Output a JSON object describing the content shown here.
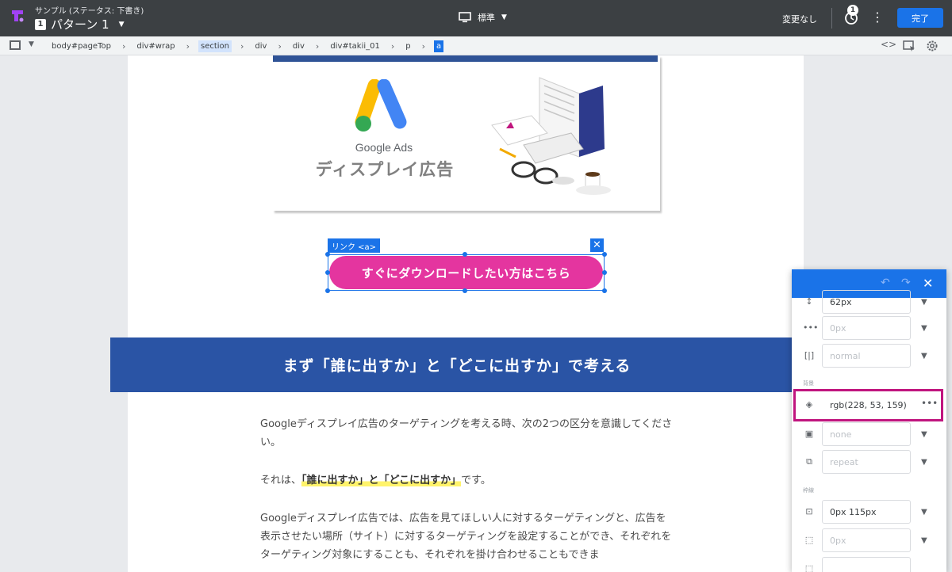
{
  "topbar": {
    "app_subtitle": "サンプル (ステータス: 下書き)",
    "pattern_number": "1",
    "pattern_name": "パターン 1",
    "device_label": "標準",
    "status_text": "変更なし",
    "timer_badge": "1",
    "done_label": "完了"
  },
  "breadcrumb": [
    {
      "label": "body#pageTop",
      "state": "normal"
    },
    {
      "label": "div#wrap",
      "state": "normal"
    },
    {
      "label": "section",
      "state": "highlight"
    },
    {
      "label": "div",
      "state": "normal"
    },
    {
      "label": "div",
      "state": "normal"
    },
    {
      "label": "div#takii_01",
      "state": "normal"
    },
    {
      "label": "p",
      "state": "normal"
    },
    {
      "label": "a",
      "state": "selected"
    }
  ],
  "hero": {
    "logo_text": "Google Ads",
    "subtitle": "ディスプレイ広告"
  },
  "selection": {
    "label": "リンク <a>",
    "close": "✕"
  },
  "cta": {
    "label": "すぐにダウンロードしたい方はこちら",
    "color": "#e4359f"
  },
  "banner": {
    "text": "まず「誰に出すか」と「どこに出すか」で考える",
    "color": "#2a54a5"
  },
  "article": {
    "p1": "Googleディスプレイ広告のターゲティングを考える時、次の2つの区分を意識してください。",
    "p2_before": "それは、",
    "p2_marker": "「誰に出すか」と「どこに出すか」",
    "p2_after": "です。",
    "p3": "Googleディスプレイ広告では、広告を見てほしい人に対するターゲティングと、広告を表示させたい場所（サイト）に対するターゲティングを設定することができ、それぞれをターゲティング対象にすることも、それぞれを掛け合わせることもできま"
  },
  "panel": {
    "line_height": "62px",
    "letter_spacing": "0px",
    "word_spacing": "normal",
    "section_background": "背景",
    "background_color": "rgb(228, 53, 159)",
    "background_image": "none",
    "background_repeat": "repeat",
    "section_border": "枠線",
    "padding": "0px 115px",
    "border": "0px",
    "highlight_color": "#c0157e"
  }
}
